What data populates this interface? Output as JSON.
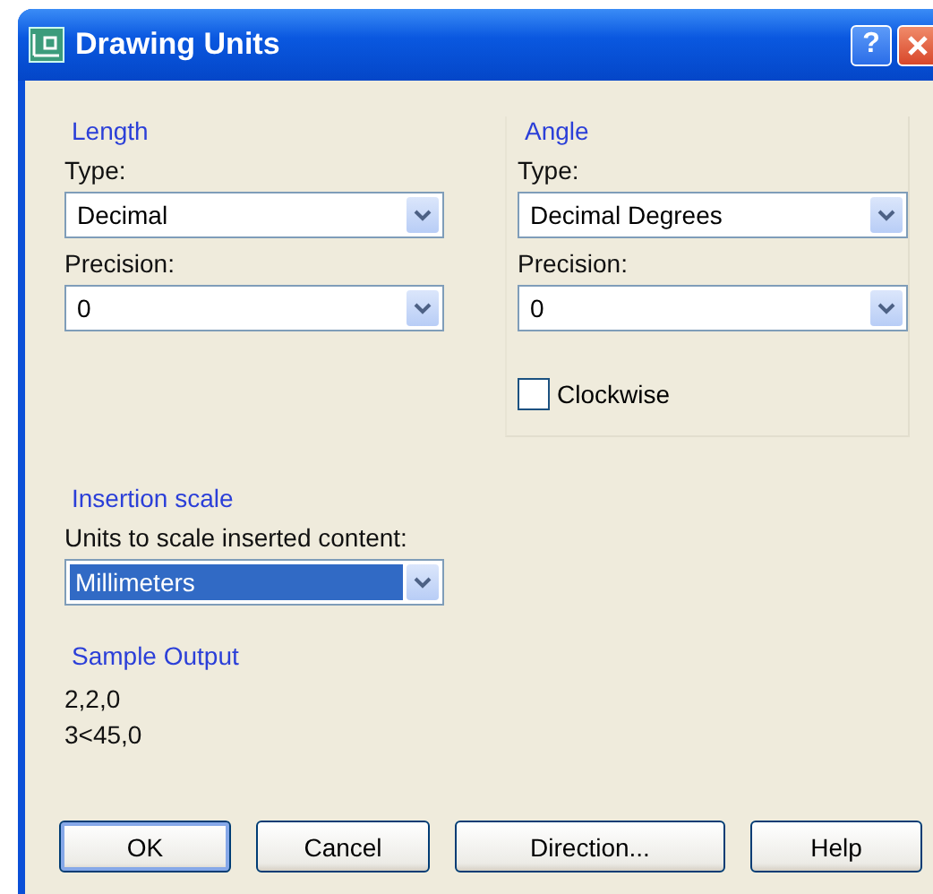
{
  "window": {
    "title": "Drawing Units",
    "help_button": "?"
  },
  "length": {
    "heading": "Length",
    "type_label": "Type:",
    "type_value": "Decimal",
    "precision_label": "Precision:",
    "precision_value": "0"
  },
  "angle": {
    "heading": "Angle",
    "type_label": "Type:",
    "type_value": "Decimal Degrees",
    "precision_label": "Precision:",
    "precision_value": "0",
    "clockwise": {
      "label": "Clockwise",
      "checked": false
    }
  },
  "insertion_scale": {
    "heading": "Insertion scale",
    "label": "Units to scale inserted content:",
    "value": "Millimeters",
    "focused": true
  },
  "sample_output": {
    "heading": "Sample Output",
    "lines": [
      "2,2,0",
      "3<45,0"
    ]
  },
  "buttons": [
    {
      "label": "OK",
      "default": true
    },
    {
      "label": "Cancel",
      "default": false
    },
    {
      "label": "Direction...",
      "default": false
    },
    {
      "label": "Help",
      "default": false
    }
  ]
}
